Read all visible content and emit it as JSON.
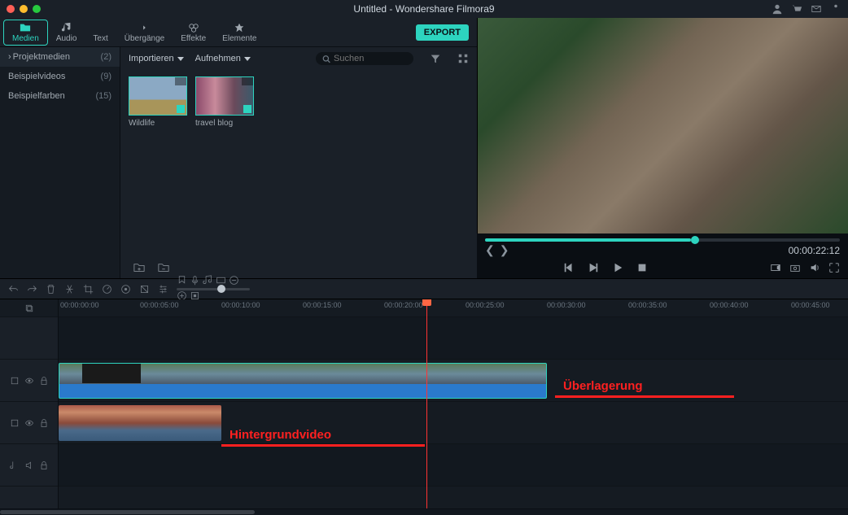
{
  "title": "Untitled - Wondershare Filmora9",
  "tabs": [
    {
      "label": "Medien",
      "icon": "folder"
    },
    {
      "label": "Audio",
      "icon": "music"
    },
    {
      "label": "Text",
      "icon": "text"
    },
    {
      "label": "Übergänge",
      "icon": "transition"
    },
    {
      "label": "Effekte",
      "icon": "effects"
    },
    {
      "label": "Elemente",
      "icon": "elements"
    }
  ],
  "export_label": "EXPORT",
  "sidebar": [
    {
      "label": "Projektmedien",
      "count": "(2)",
      "active": true
    },
    {
      "label": "Beispielvideos",
      "count": "(9)"
    },
    {
      "label": "Beispielfarben",
      "count": "(15)"
    }
  ],
  "media_toolbar": {
    "import": "Importieren",
    "record": "Aufnehmen",
    "search_placeholder": "Suchen"
  },
  "media_items": [
    {
      "name": "Wildlife"
    },
    {
      "name": "travel blog"
    }
  ],
  "preview": {
    "time": "00:00:22:12"
  },
  "ruler_ticks": [
    "00:00:00:00",
    "00:00:05:00",
    "00:00:10:00",
    "00:00:15:00",
    "00:00:20:00",
    "00:00:25:00",
    "00:00:30:00",
    "00:00:35:00",
    "00:00:40:00",
    "00:00:45:00"
  ],
  "annotations": {
    "overlay": "Überlagerung",
    "background": "Hintergrundvideo"
  }
}
